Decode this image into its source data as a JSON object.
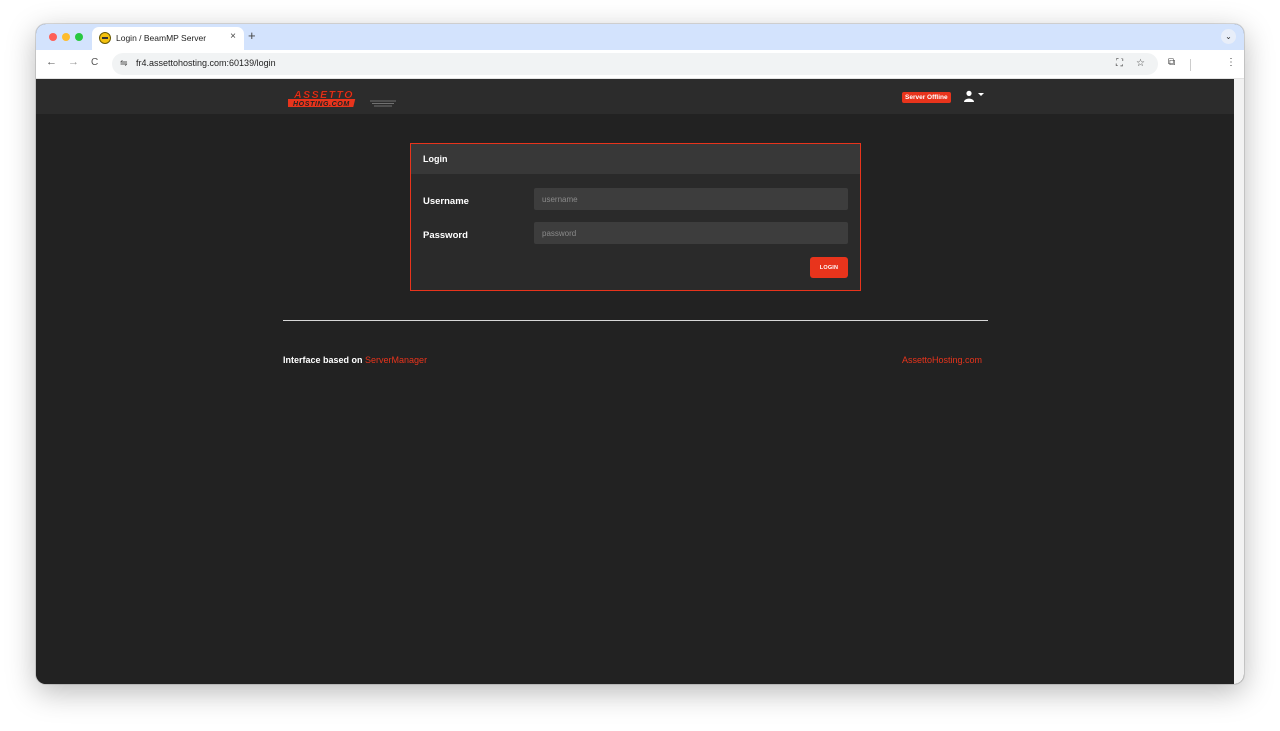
{
  "browser": {
    "tab_title": "Login / BeamMP Server",
    "close_glyph": "×",
    "new_tab_glyph": "+",
    "tab_menu_glyph": "⌄",
    "url": "fr4.assettohosting.com:60139/login",
    "back_glyph": "←",
    "forward_glyph": "→",
    "reload_glyph": "C",
    "site_info_glyph": "⇋",
    "translate_glyph": "⛶",
    "bookmark_glyph": "☆",
    "extensions_glyph": "⧉",
    "menu_glyph": "⋮"
  },
  "header": {
    "logo_line1": "ASSETTO",
    "logo_line2": "HOSTING.COM",
    "server_status": "Server Offline"
  },
  "login": {
    "title": "Login",
    "username_label": "Username",
    "username_placeholder": "username",
    "password_label": "Password",
    "password_placeholder": "password",
    "button_label": "LOGIN"
  },
  "footer": {
    "left_prefix": "Interface based on ",
    "left_link": "ServerManager",
    "right_link": "AssettoHosting.com"
  },
  "colors": {
    "accent": "#e8341c",
    "page_bg": "#222222",
    "nav_bg": "#2c2c2c",
    "card_header_bg": "#383838",
    "input_bg": "#3d3d3d"
  }
}
